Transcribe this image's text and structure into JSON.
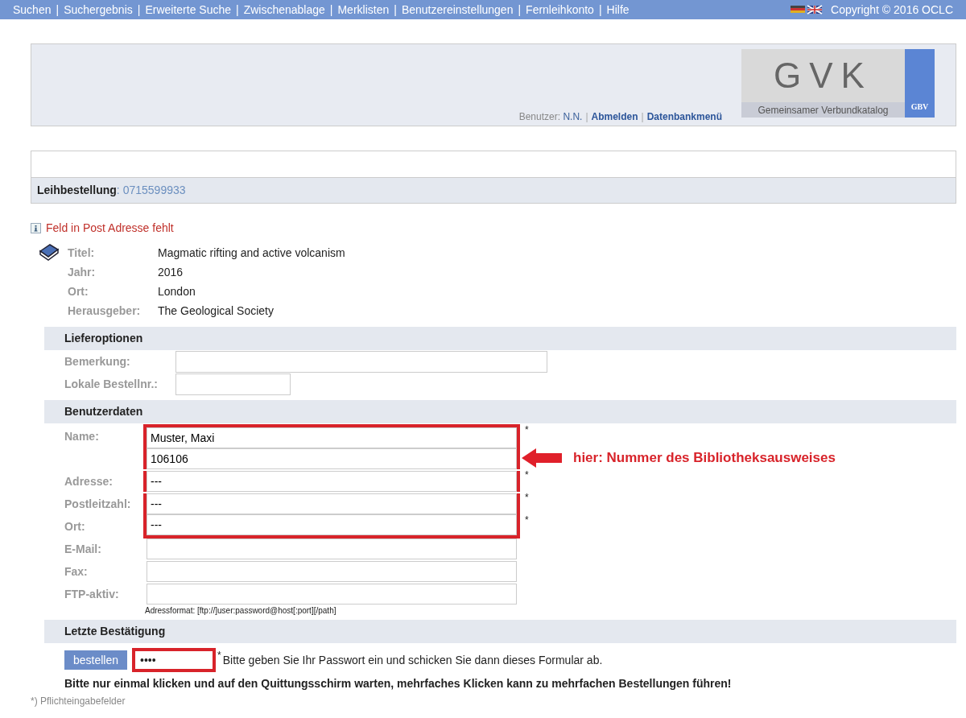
{
  "top_nav": {
    "links": [
      "Suchen",
      "Suchergebnis",
      "Erweiterte Suche",
      "Zwischenablage",
      "Merklisten",
      "Benutzereinstellungen",
      "Fernleihkonto",
      "Hilfe"
    ],
    "separator": "|",
    "copyright": "Copyright © 2016 OCLC"
  },
  "header": {
    "user_label": "Benutzer:",
    "user_name": "N.N.",
    "links": [
      "Abmelden",
      "Datenbankmenü"
    ],
    "separator": "|",
    "logo": {
      "title": "GVK",
      "subtitle": "Gemeinsamer Verbundkatalog",
      "badge": "GBV"
    }
  },
  "order": {
    "label": "Leihbestellung",
    "separator": ":",
    "number": "0715599933"
  },
  "message": "Feld in Post Adresse fehlt",
  "record": [
    {
      "label": "Titel:",
      "value": "Magmatic rifting and active volcanism"
    },
    {
      "label": "Jahr:",
      "value": "2016"
    },
    {
      "label": "Ort:",
      "value": "London"
    },
    {
      "label": "Herausgeber:",
      "value": "The Geological Society"
    }
  ],
  "delivery": {
    "heading": "Lieferoptionen",
    "fields": [
      {
        "label": "Bemerkung:",
        "kind": "wide"
      },
      {
        "label": "Lokale Bestellnr.:",
        "kind": "narrow"
      }
    ]
  },
  "user_data": {
    "heading": "Benutzerdaten",
    "annotation": "hier: Nummer des Bibliotheksausweises",
    "fields": [
      {
        "label": "Name:",
        "value": "Muster, Maxi",
        "required": true,
        "highlighted": true
      },
      {
        "value": "106106",
        "required": false,
        "highlighted": true
      },
      {
        "label": "Adresse:",
        "value": "---",
        "required": true,
        "highlighted": true
      },
      {
        "label": "Postleitzahl:",
        "value": "---",
        "required": true,
        "highlighted": true
      },
      {
        "label": "Ort:",
        "value": "---",
        "required": true,
        "highlighted": true
      },
      {
        "label": "E-Mail:",
        "required": false,
        "highlighted": false
      },
      {
        "label": "Fax:",
        "required": false,
        "highlighted": false
      },
      {
        "label": "FTP-aktiv:",
        "required": false,
        "highlighted": false
      }
    ],
    "hint": "Adressformat: [ftp://]user:password@host[:port][/path]"
  },
  "confirmation": {
    "heading": "Letzte Bestätigung",
    "button": "bestellen",
    "password": "••••",
    "password_highlighted": true,
    "required_mark": "*",
    "instruction": "Bitte geben Sie Ihr Passwort ein und schicken Sie dann dieses Formular ab.",
    "warning": "Bitte nur einmal klicken und auf den Quittungsschirm warten, mehrfaches Klicken kann zu mehrfachen Bestellungen führen!"
  },
  "footnote": "*) Pflichteingabefelder"
}
